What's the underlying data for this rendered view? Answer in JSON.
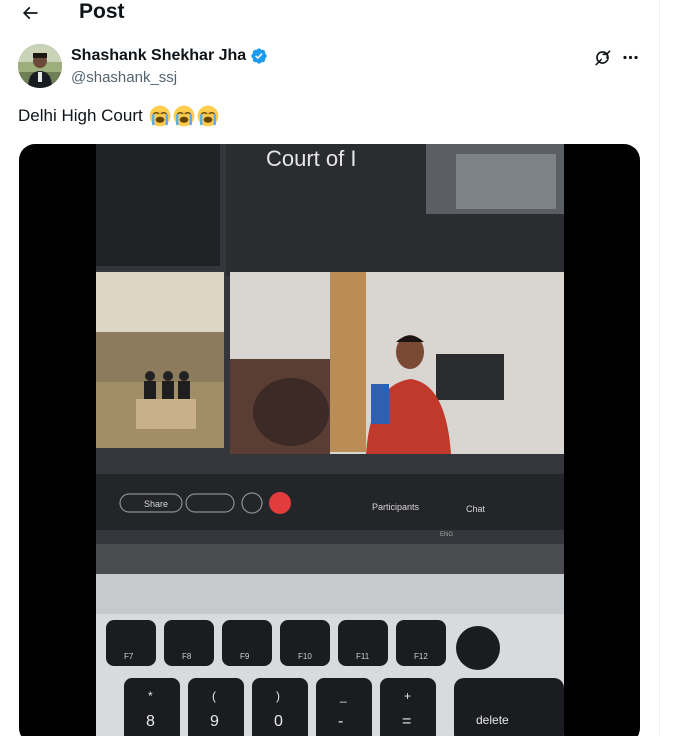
{
  "header": {
    "back_icon": "arrow-left-icon",
    "title": "Post"
  },
  "author": {
    "display_name": "Shashank Shekhar Jha",
    "handle": "@shashank_ssj",
    "verified": true,
    "verified_color": "#1d9bf0",
    "grok_icon": "grok-icon",
    "more_icon": "more-horizontal-icon"
  },
  "post": {
    "text": "Delhi High Court",
    "emoji_count": 3,
    "emoji_name": "loudly-crying-face"
  },
  "video": {
    "signage_text": "Court of I",
    "toolbar": {
      "share": "Share",
      "participants": "Participants",
      "chat": "Chat",
      "lang": "ENG"
    },
    "keyboard": {
      "fkeys": [
        "F7",
        "F8",
        "F9",
        "F10",
        "F11",
        "F12"
      ],
      "number_keys": [
        {
          "top": "*",
          "bottom": "8"
        },
        {
          "top": "(",
          "bottom": "9"
        },
        {
          "top": ")",
          "bottom": "0"
        },
        {
          "top": "_",
          "bottom": "-"
        },
        {
          "top": "+",
          "bottom": "="
        }
      ],
      "delete": "delete"
    }
  }
}
